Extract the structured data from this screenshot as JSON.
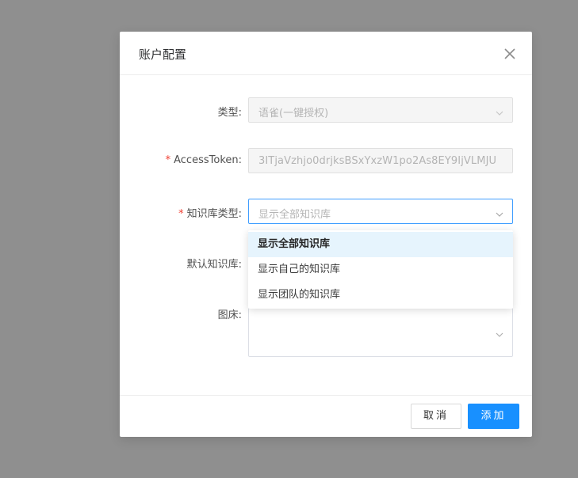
{
  "modal": {
    "title": "账户配置",
    "fields": {
      "type": {
        "label": "类型:",
        "value": "语雀(一键授权)",
        "required": false
      },
      "token": {
        "label": "AccessToken:",
        "value": "3ITjaVzhjo0drjksBSxYxzW1po2As8EY9IjVLMJU",
        "required": true
      },
      "kbType": {
        "label": "知识库类型:",
        "placeholder": "显示全部知识库",
        "required": true
      },
      "defaultKb": {
        "label": "默认知识库:",
        "required": false
      },
      "imageBed": {
        "label": "图床:",
        "required": false
      }
    },
    "required_mark": "*",
    "dropdown": {
      "options": [
        "显示全部知识库",
        "显示自己的知识库",
        "显示团队的知识库"
      ],
      "selected_index": 0
    },
    "footer": {
      "cancel_label": "取消",
      "confirm_label": "添加"
    }
  },
  "colors": {
    "primary": "#1890ff",
    "overlay": "#8f8f8f",
    "required": "#f04134"
  }
}
